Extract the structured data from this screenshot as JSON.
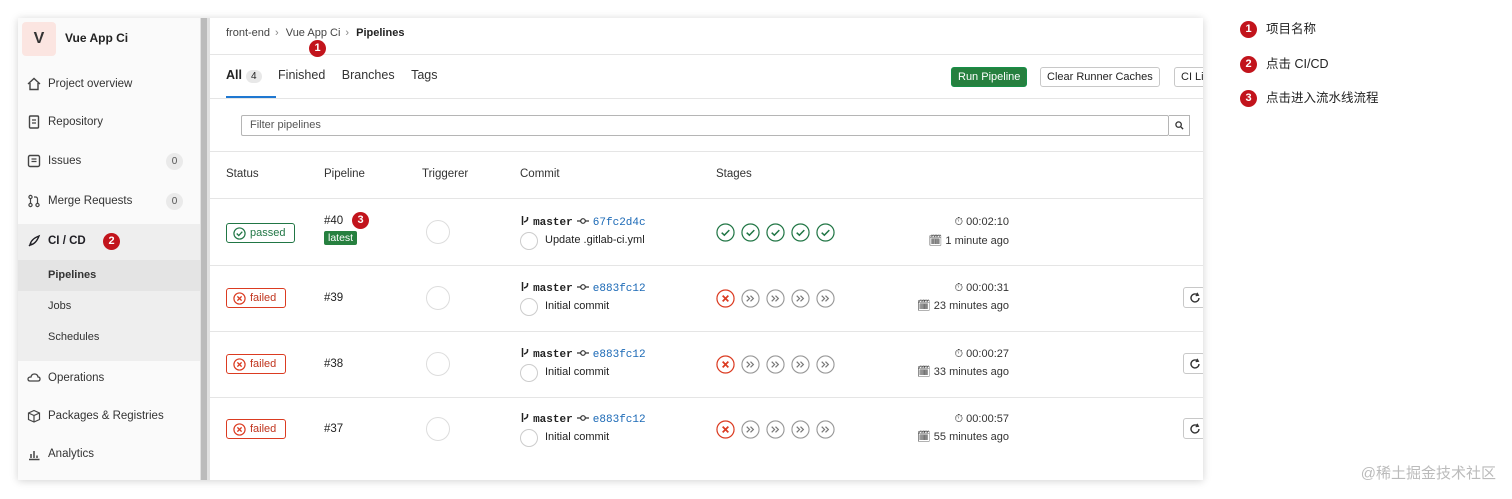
{
  "project": {
    "avatar_letter": "V",
    "name": "Vue App Ci"
  },
  "sidebar": {
    "items": [
      {
        "label": "Project overview",
        "icon": "home-icon"
      },
      {
        "label": "Repository",
        "icon": "document-icon"
      },
      {
        "label": "Issues",
        "icon": "issues-icon",
        "count": "0"
      },
      {
        "label": "Merge Requests",
        "icon": "merge-request-icon",
        "count": "0"
      },
      {
        "label": "CI / CD",
        "icon": "rocket-icon"
      },
      {
        "label": "Operations",
        "icon": "cloud-gear-icon"
      },
      {
        "label": "Packages & Registries",
        "icon": "package-icon"
      },
      {
        "label": "Analytics",
        "icon": "chart-icon"
      }
    ],
    "ci_sub_items": [
      "Pipelines",
      "Jobs",
      "Schedules"
    ]
  },
  "breadcrumb": [
    "front-end",
    "Vue App Ci",
    "Pipelines"
  ],
  "tabs": [
    {
      "label": "All",
      "count": "4"
    },
    {
      "label": "Finished"
    },
    {
      "label": "Branches"
    },
    {
      "label": "Tags"
    }
  ],
  "buttons": {
    "run_pipeline": "Run Pipeline",
    "clear_caches": "Clear Runner Caches",
    "ci_lint": "CI Lint"
  },
  "filter": {
    "placeholder": "Filter pipelines"
  },
  "table": {
    "headers": [
      "Status",
      "Pipeline",
      "Triggerer",
      "Commit",
      "Stages"
    ],
    "rows": [
      {
        "status": "passed",
        "id": "#40",
        "tag": "latest",
        "branch": "master",
        "sha": "67fc2d4c",
        "message": "Update .gitlab-ci.yml",
        "duration": "00:02:10",
        "finished": "1 minute ago"
      },
      {
        "status": "failed",
        "id": "#39",
        "branch": "master",
        "sha": "e883fc12",
        "message": "Initial commit",
        "duration": "00:00:31",
        "finished": "23 minutes ago"
      },
      {
        "status": "failed",
        "id": "#38",
        "branch": "master",
        "sha": "e883fc12",
        "message": "Initial commit",
        "duration": "00:00:27",
        "finished": "33 minutes ago"
      },
      {
        "status": "failed",
        "id": "#37",
        "branch": "master",
        "sha": "e883fc12",
        "message": "Initial commit",
        "duration": "00:00:57",
        "finished": "55 minutes ago"
      }
    ]
  },
  "annotations": [
    {
      "number": "1",
      "text": "项目名称"
    },
    {
      "number": "2",
      "text": "点击 CI/CD"
    },
    {
      "number": "3",
      "text": "点击进入流水线流程"
    }
  ],
  "watermark": "@稀土掘金技术社区",
  "colors": {
    "accent_green": "#26803f",
    "failed_red": "#db3b21",
    "link_blue": "#1b69b6",
    "marker_red": "#c2141c"
  }
}
